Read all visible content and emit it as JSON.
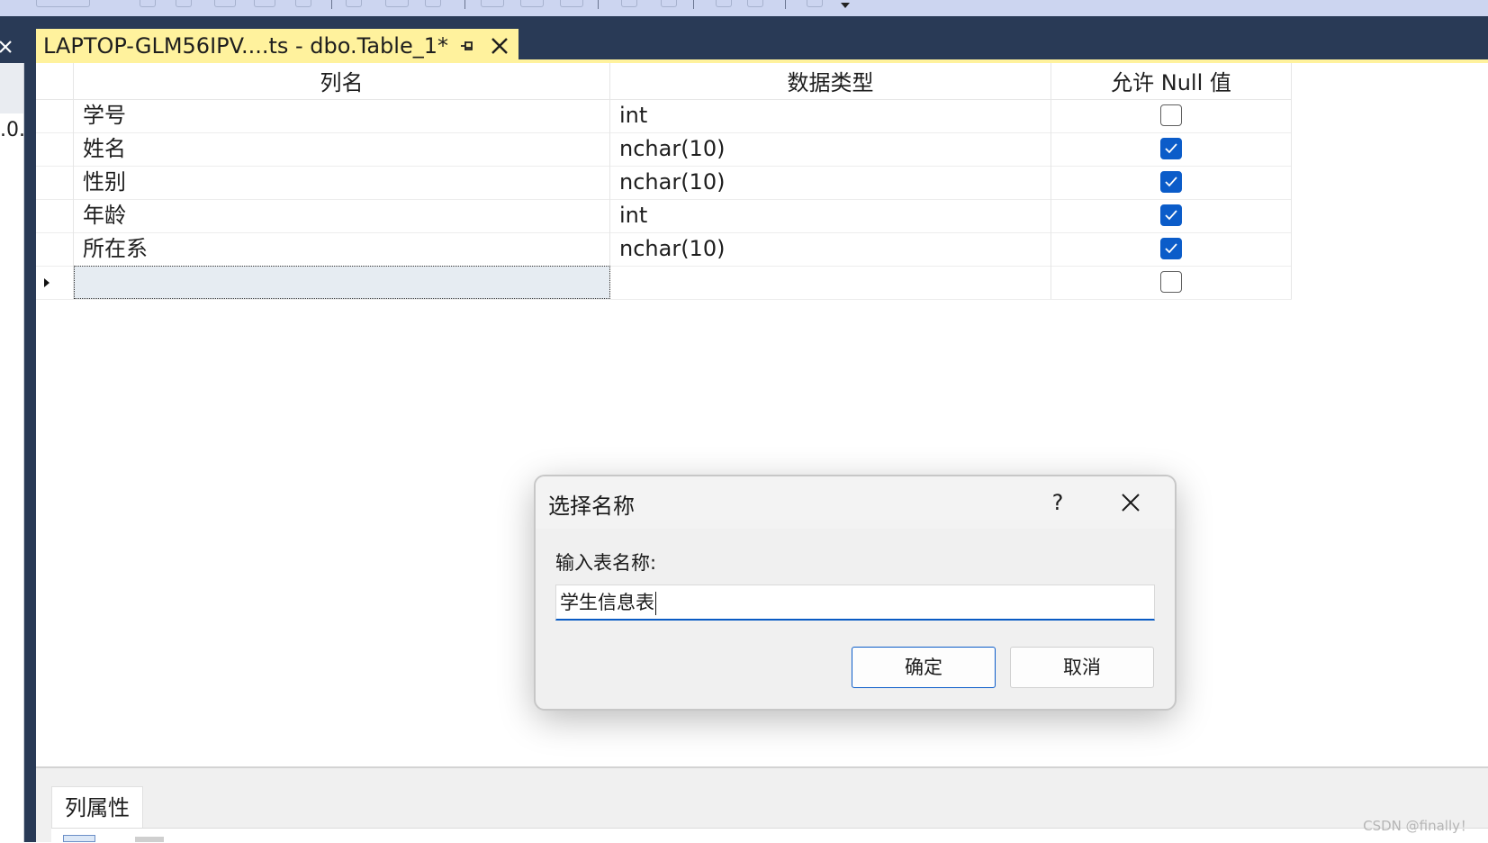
{
  "document_tab": {
    "title": "LAPTOP-GLM56IPV....ts - dbo.Table_1*"
  },
  "left_panel": {
    "text": ".0."
  },
  "grid": {
    "headers": [
      "列名",
      "数据类型",
      "允许 Null 值"
    ],
    "rows": [
      {
        "name": "学号",
        "type": "int",
        "allow_null": false
      },
      {
        "name": "姓名",
        "type": "nchar(10)",
        "allow_null": true
      },
      {
        "name": "性别",
        "type": "nchar(10)",
        "allow_null": true
      },
      {
        "name": "年龄",
        "type": "int",
        "allow_null": true
      },
      {
        "name": "所在系",
        "type": "nchar(10)",
        "allow_null": true
      },
      {
        "name": "",
        "type": "",
        "allow_null": false
      }
    ]
  },
  "properties_panel": {
    "tab_label": "列属性"
  },
  "dialog": {
    "title": "选择名称",
    "help_label": "?",
    "field_label": "输入表名称:",
    "input_value": "学生信息表",
    "ok_label": "确定",
    "cancel_label": "取消"
  },
  "watermark": "CSDN @finally！",
  "colors": {
    "tab_bar": "#293a56",
    "active_tab": "#fff29d",
    "checkbox_checked": "#0b5cc9",
    "toolbar": "#ccd5f0"
  }
}
